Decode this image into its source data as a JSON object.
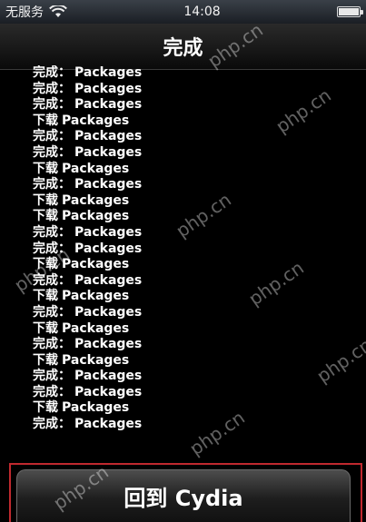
{
  "status_bar": {
    "carrier": "无服务",
    "time": "14:08"
  },
  "nav": {
    "title": "完成"
  },
  "log": [
    {
      "status": "完成：",
      "pkg": "Packages"
    },
    {
      "status": "完成：",
      "pkg": "Packages"
    },
    {
      "status": "完成：",
      "pkg": "Packages"
    },
    {
      "status": "下载",
      "pkg": "Packages"
    },
    {
      "status": "完成：",
      "pkg": "Packages"
    },
    {
      "status": "完成：",
      "pkg": "Packages"
    },
    {
      "status": "下载",
      "pkg": "Packages"
    },
    {
      "status": "完成：",
      "pkg": "Packages"
    },
    {
      "status": "下载",
      "pkg": "Packages"
    },
    {
      "status": "下载",
      "pkg": "Packages"
    },
    {
      "status": "完成：",
      "pkg": "Packages"
    },
    {
      "status": "完成：",
      "pkg": "Packages"
    },
    {
      "status": "下载",
      "pkg": "Packages"
    },
    {
      "status": "完成：",
      "pkg": "Packages"
    },
    {
      "status": "下载",
      "pkg": "Packages"
    },
    {
      "status": "完成：",
      "pkg": "Packages"
    },
    {
      "status": "下载",
      "pkg": "Packages"
    },
    {
      "status": "完成：",
      "pkg": "Packages"
    },
    {
      "status": "下载",
      "pkg": "Packages"
    },
    {
      "status": "完成：",
      "pkg": "Packages"
    },
    {
      "status": "完成：",
      "pkg": "Packages"
    },
    {
      "status": "下载",
      "pkg": "Packages"
    },
    {
      "status": "完成：",
      "pkg": "Packages"
    }
  ],
  "return_button": {
    "label": "回到 Cydia"
  },
  "watermark": {
    "text": "php.cn"
  }
}
